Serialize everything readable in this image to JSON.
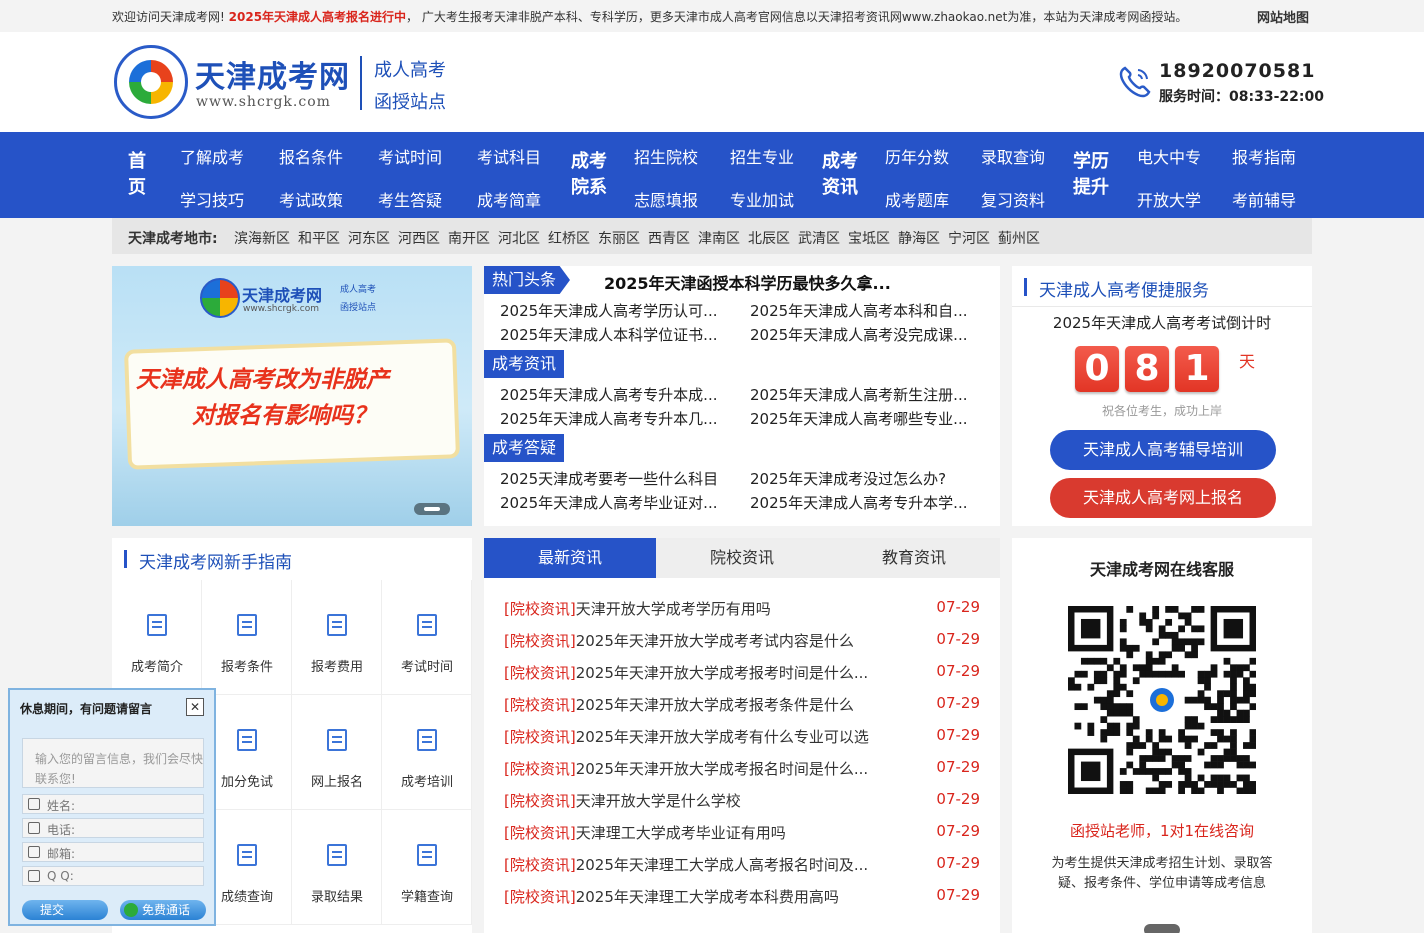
{
  "topbar": {
    "notice_pre": "欢迎访问天津成考网! ",
    "notice_highlight": "2025年天津成人高考报名进行中",
    "notice_post": "， 广大考生报考天津非脱产本科、专科学历，更多天津市成人高考官网信息以天津招考资讯网www.zhaokao.net为准，本站为天津成考网函授站。",
    "sitemap": "网站地图"
  },
  "header": {
    "site_name": "天津成考网",
    "site_url": "www.shcrgk.com",
    "slogan_line1": "成人高考",
    "slogan_line2": "函授站点",
    "phone": "18920070581",
    "service_time": "服务时间：08:33-22:00"
  },
  "nav": {
    "home": "首页",
    "group1": [
      "了解成考",
      "报名条件",
      "考试时间",
      "考试科目",
      "学习技巧",
      "考试政策",
      "考生答疑",
      "成考简章"
    ],
    "group2_title": "成考院系",
    "group2": [
      "招生院校",
      "招生专业",
      "志愿填报",
      "专业加试"
    ],
    "group3_title": "成考资讯",
    "group3": [
      "历年分数",
      "录取查询",
      "成考题库",
      "复习资料"
    ],
    "group4_title": "学历提升",
    "group4": [
      "电大中专",
      "报考指南",
      "开放大学",
      "考前辅导"
    ]
  },
  "regions": {
    "label": "天津成考地市:",
    "list": [
      "滨海新区",
      "和平区",
      "河东区",
      "河西区",
      "南开区",
      "河北区",
      "红桥区",
      "东丽区",
      "西青区",
      "津南区",
      "北辰区",
      "武清区",
      "宝坻区",
      "静海区",
      "宁河区",
      "蓟州区"
    ]
  },
  "banner": {
    "site_name": "天津成考网",
    "site_url": "www.shcrgk.com",
    "slogan_line1": "成人高考",
    "slogan_line2": "函授站点",
    "headline_line1": "天津成人高考改为非脱产",
    "headline_line2": "对报名有影响吗？"
  },
  "news_top": {
    "hot_tag": "热门头条",
    "hot_title": "2025年天津函授本科学历最快多久拿...",
    "hot_items": [
      "2025年天津成人高考学历认可...",
      "2025年天津成人高考本科和自...",
      "2025年天津成人本科学位证书...",
      "2025年天津成人高考没完成课..."
    ],
    "section2_tag": "成考资讯",
    "section2_items": [
      "2025年天津成人高考专升本成...",
      "2025年天津成人高考新生注册...",
      "2025年天津成人高考专升本几...",
      "2025年天津成人高考哪些专业..."
    ],
    "section3_tag": "成考答疑",
    "section3_items": [
      "2025天津成考要考一些什么科目",
      "2025年天津成考没过怎么办?",
      "2025年天津成人高考毕业证对...",
      "2025年天津成人高考专升本学..."
    ]
  },
  "service": {
    "title": "天津成人高考便捷服务",
    "countdown_label": "2025年天津成人高考考试倒计时",
    "digits": [
      "0",
      "8",
      "1"
    ],
    "unit": "天",
    "wish": "祝各位考生，成功上岸",
    "btn_training": "天津成人高考辅导培训",
    "btn_signup": "天津成人高考网上报名",
    "color_blue": "#2653c8",
    "color_red": "#d93a2f"
  },
  "guide": {
    "title": "天津成考网新手指南",
    "items": [
      "成考简介",
      "报考条件",
      "报考费用",
      "考试时间",
      "",
      "加分免试",
      "网上报名",
      "成考培训",
      "",
      "成绩查询",
      "录取结果",
      "学籍查询"
    ]
  },
  "news_tabs": {
    "tabs": [
      "最新资讯",
      "院校资讯",
      "教育资讯"
    ],
    "items": [
      {
        "cat": "[院校资讯]",
        "title": "天津开放大学成考学历有用吗",
        "date": "07-29"
      },
      {
        "cat": "[院校资讯]",
        "title": "2025年天津开放大学成考考试内容是什么",
        "date": "07-29"
      },
      {
        "cat": "[院校资讯]",
        "title": "2025年天津开放大学成考报考时间是什么...",
        "date": "07-29"
      },
      {
        "cat": "[院校资讯]",
        "title": "2025年天津开放大学成考报考条件是什么",
        "date": "07-29"
      },
      {
        "cat": "[院校资讯]",
        "title": "2025年天津开放大学成考有什么专业可以选",
        "date": "07-29"
      },
      {
        "cat": "[院校资讯]",
        "title": "2025年天津开放大学成考报名时间是什么...",
        "date": "07-29"
      },
      {
        "cat": "[院校资讯]",
        "title": "天津开放大学是什么学校",
        "date": "07-29"
      },
      {
        "cat": "[院校资讯]",
        "title": "天津理工大学成考毕业证有用吗",
        "date": "07-29"
      },
      {
        "cat": "[院校资讯]",
        "title": "2025年天津理工大学成人高考报名时间及...",
        "date": "07-29"
      },
      {
        "cat": "[院校资讯]",
        "title": "2025年天津理工大学成考本科费用高吗",
        "date": "07-29"
      }
    ]
  },
  "kefu": {
    "title": "天津成考网在线客服",
    "consult": "函授站老师，1对1在线咨询",
    "desc": "为考生提供天津成考招生计划、录取答疑、报考条件、学位申请等成考信息"
  },
  "message_box": {
    "header": "休息期间，有问题请留言",
    "close": "✕",
    "placeholder": "输入您的留言信息，我们会尽快联系您!",
    "name_label": "姓名:",
    "phone_label": "电话:",
    "email_label": "邮箱:",
    "qq_label": "Q  Q:",
    "submit": "提交",
    "free_call": "免费通话"
  }
}
